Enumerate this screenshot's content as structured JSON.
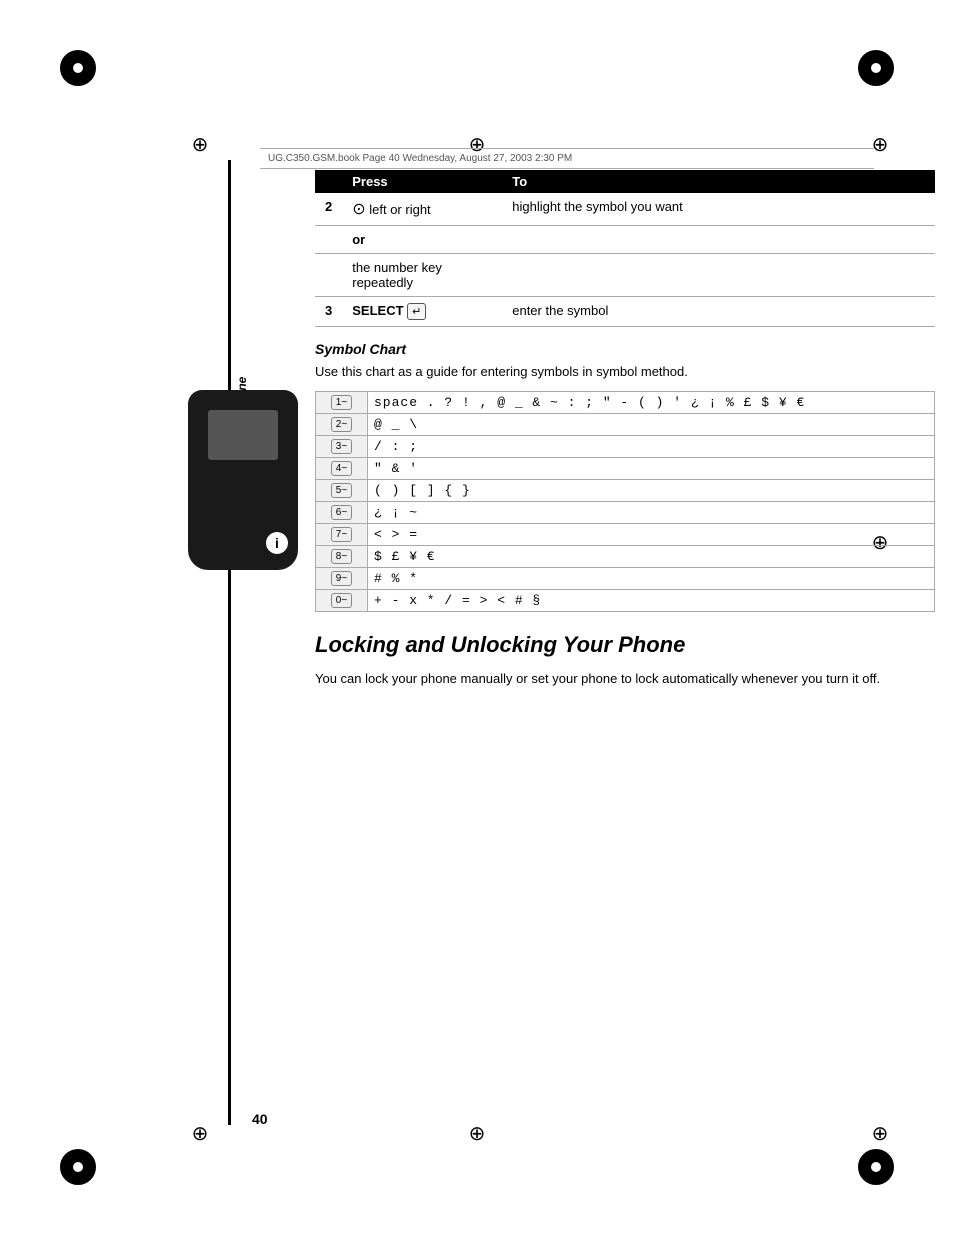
{
  "page": {
    "number": "40",
    "header_text": "UG.C350.GSM.book  Page 40  Wednesday, August 27, 2003  2:30 PM"
  },
  "instruction_table": {
    "col_press": "Press",
    "col_to": "To",
    "rows": [
      {
        "num": "2",
        "press": "⊙ left or right",
        "to": "highlight the symbol you want"
      },
      {
        "num": "",
        "press": "or",
        "to": ""
      },
      {
        "num": "",
        "press": "the number key\nrepeatedly",
        "to": ""
      },
      {
        "num": "3",
        "press": "SELECT (↵)",
        "to": "enter the symbol"
      }
    ]
  },
  "symbol_chart": {
    "title": "Symbol Chart",
    "description": "Use this chart as a guide for entering symbols in symbol method.",
    "rows": [
      {
        "key": "1~",
        "symbols": "space . ? ! , @ _ & ~ : ; \" - ( ) ' ¿ ¡ % £ $ ¥    €"
      },
      {
        "key": "2~",
        "symbols": "@ _ \\"
      },
      {
        "key": "3~",
        "symbols": "/ : ;"
      },
      {
        "key": "4~",
        "symbols": "\" & '"
      },
      {
        "key": "5~",
        "symbols": "( ) [ ] { }"
      },
      {
        "key": "6~",
        "symbols": "¿ ¡ ~"
      },
      {
        "key": "7~",
        "symbols": "< > ="
      },
      {
        "key": "8~",
        "symbols": "$ £ ¥    €"
      },
      {
        "key": "9~",
        "symbols": "# % *"
      },
      {
        "key": "0~",
        "symbols": "+ - x * / = > < # §"
      }
    ]
  },
  "locking": {
    "title": "Locking and Unlocking Your Phone",
    "description": "You can lock your phone manually or set your phone to lock automatically whenever you turn it off."
  },
  "side_label": "Learning to Use Your Phone",
  "phone": {
    "info_icon": "i"
  }
}
